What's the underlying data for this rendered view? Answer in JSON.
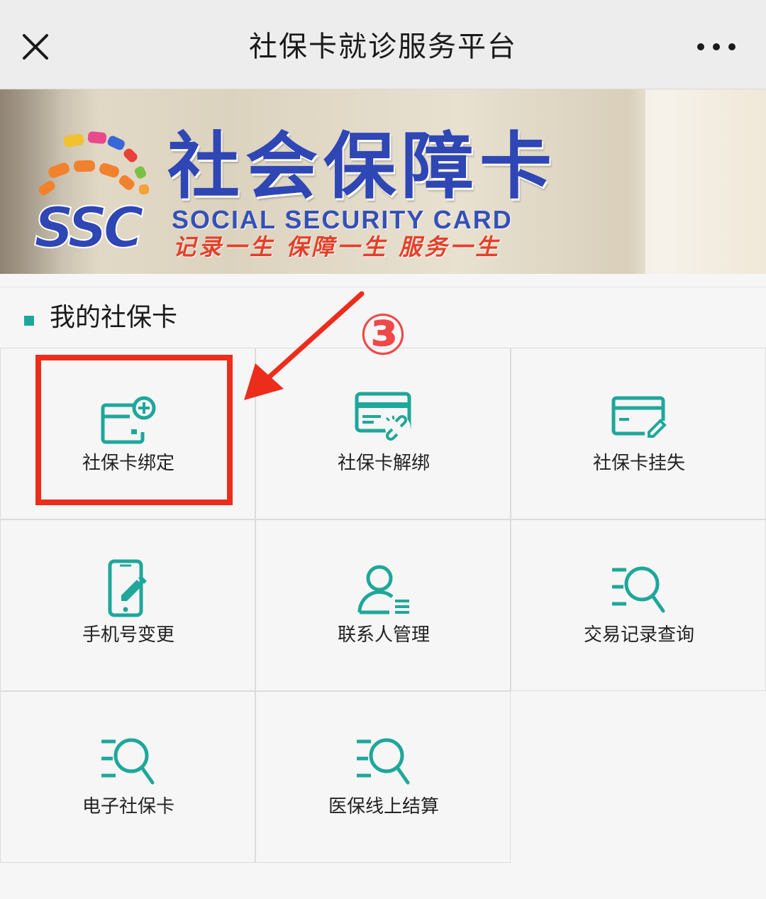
{
  "navbar": {
    "title": "社保卡就诊服务平台",
    "close_icon": "close-icon",
    "more_icon": "more-icon"
  },
  "banner": {
    "title": "社会保障卡",
    "logo_text": "SSC",
    "subtitle_en": "SOCIAL SECURITY CARD",
    "slogan": "记录一生  保障一生  服务一生"
  },
  "section": {
    "title": "我的社保卡"
  },
  "services": [
    {
      "label": "社保卡绑定",
      "icon": "card-add-icon"
    },
    {
      "label": "社保卡解绑",
      "icon": "card-unlink-icon"
    },
    {
      "label": "社保卡挂失",
      "icon": "card-report-loss-icon"
    },
    {
      "label": "手机号变更",
      "icon": "phone-edit-icon"
    },
    {
      "label": "联系人管理",
      "icon": "contact-manage-icon"
    },
    {
      "label": "交易记录查询",
      "icon": "search-list-icon"
    },
    {
      "label": "电子社保卡",
      "icon": "search-list-icon"
    },
    {
      "label": "医保线上结算",
      "icon": "search-list-icon"
    }
  ],
  "annotation": {
    "step_number": "③"
  },
  "colors": {
    "accent": "#1fa79b",
    "annotation": "#ec2d1b",
    "banner_title": "#2f46b5"
  }
}
